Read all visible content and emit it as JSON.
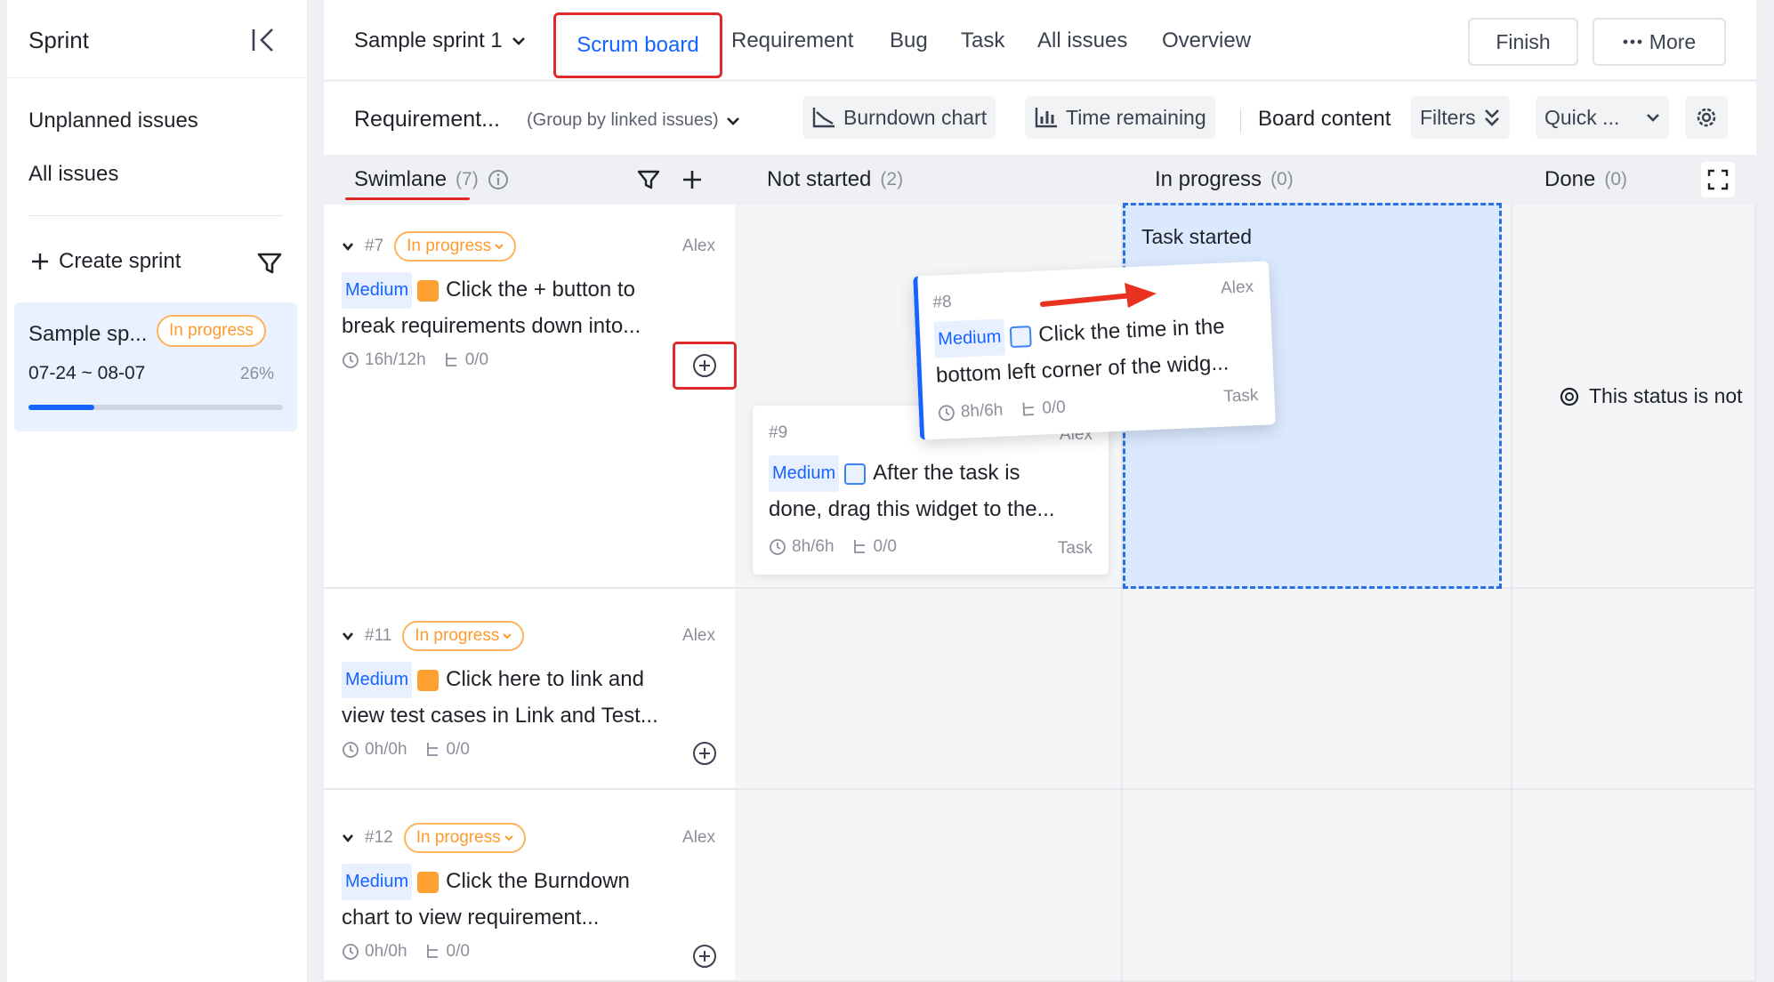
{
  "sidebar": {
    "title": "Sprint",
    "links": [
      "Unplanned issues",
      "All issues"
    ],
    "create_label": "Create sprint",
    "sprint": {
      "name": "Sample sp...",
      "status": "In progress",
      "dates": "07-24 ~ 08-07",
      "progress_label": "26%",
      "progress": 0.26
    }
  },
  "topnav": {
    "sprint_select": "Sample sprint 1",
    "tabs": [
      "Scrum board",
      "Requirement",
      "Bug",
      "Task",
      "All issues",
      "Overview"
    ],
    "finish_label": "Finish",
    "more_label": "More"
  },
  "toolbar": {
    "requirement_label": "Requirement...",
    "group_label": "(Group by linked issues)",
    "burndown_label": "Burndown chart",
    "time_remaining_label": "Time remaining",
    "board_content_label": "Board content",
    "filters_label": "Filters",
    "quick_label": "Quick ..."
  },
  "columns": {
    "swimlane": {
      "label": "Swimlane",
      "count": "(7)"
    },
    "not_started": {
      "label": "Not started",
      "count": "(2)"
    },
    "in_progress": {
      "label": "In progress",
      "count": "(0)"
    },
    "done": {
      "label": "Done",
      "count": "(0)"
    }
  },
  "lanes": [
    {
      "id": "#7",
      "status": "In progress",
      "assignee": "Alex",
      "priority": "Medium",
      "line1": "Click the + button to",
      "line2": "break requirements down into...",
      "time": "16h/12h",
      "subtasks": "0/0"
    },
    {
      "id": "#11",
      "status": "In progress",
      "assignee": "Alex",
      "priority": "Medium",
      "line1": "Click here to link and",
      "line2": "view test cases in Link and Test...",
      "time": "0h/0h",
      "subtasks": "0/0"
    },
    {
      "id": "#12",
      "status": "In progress",
      "assignee": "Alex",
      "priority": "Medium",
      "line1": "Click the Burndown",
      "line2": "chart to view requirement...",
      "time": "0h/0h",
      "subtasks": "0/0"
    }
  ],
  "tasks": {
    "t9": {
      "id": "#9",
      "assignee": "Alex",
      "priority": "Medium",
      "line1": "After the task is",
      "line2": "done, drag this widget to the...",
      "time": "8h/6h",
      "subtasks": "0/0",
      "type": "Task"
    },
    "t8": {
      "id": "#8",
      "assignee": "Alex",
      "priority": "Medium",
      "line1": "Click the time in the",
      "line2": "bottom left corner of the widg...",
      "time": "8h/6h",
      "subtasks": "0/0",
      "type": "Task"
    }
  },
  "drop_zone_label": "Task started",
  "done_status_note": "This status is not",
  "colors": {
    "accent": "#1664ff",
    "highlight_red": "#e02a2a",
    "status_orange": "#ff9a2e",
    "drop_zone_fill": "#dbe9ff"
  },
  "icons": [
    "collapse-icon",
    "plus-icon",
    "filter-icon",
    "chevron-down-icon",
    "burndown-icon",
    "bar-chart-icon",
    "double-chevron-icon",
    "gear-icon",
    "info-icon",
    "fullscreen-icon",
    "clock-icon",
    "subtask-icon",
    "add-circle-icon",
    "requirement-type-icon",
    "task-type-icon",
    "arrow-icon",
    "blocked-icon"
  ]
}
